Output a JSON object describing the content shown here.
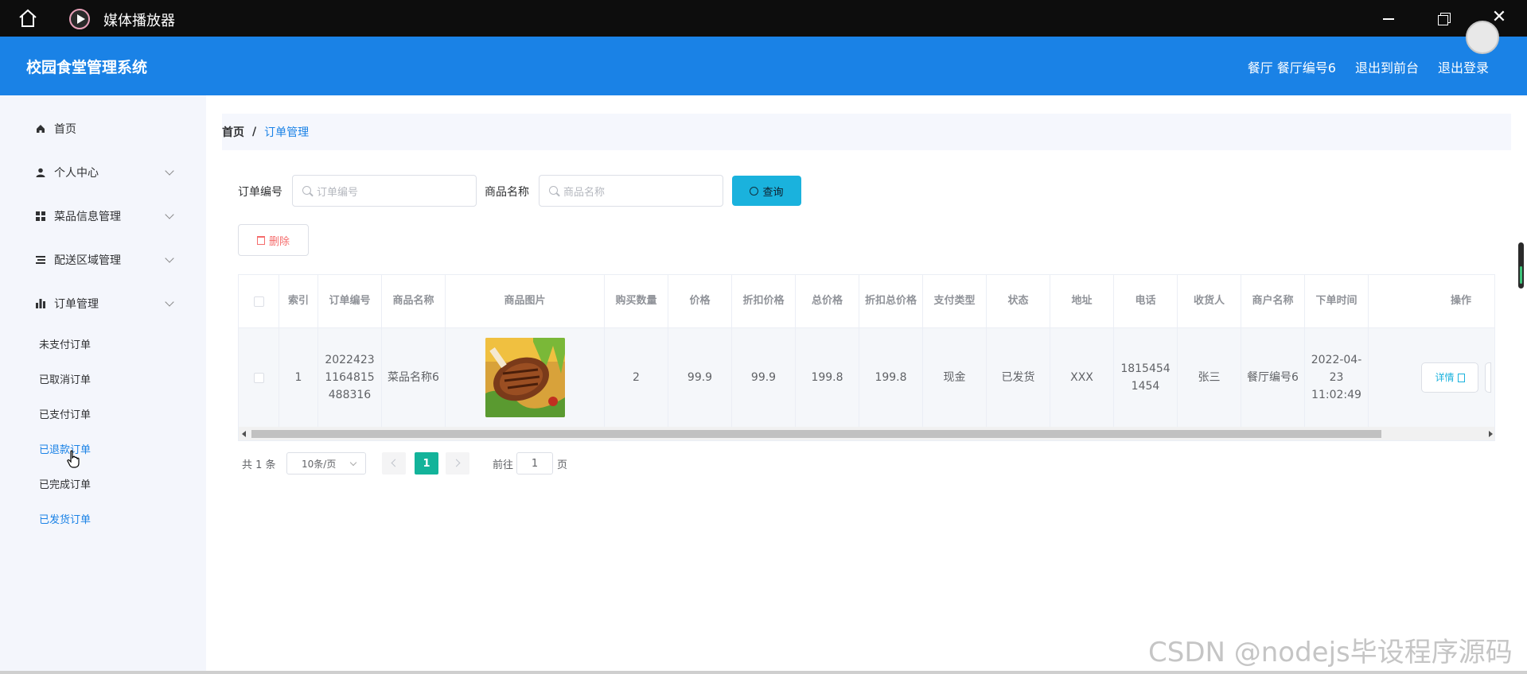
{
  "window": {
    "app_title": "媒体播放器"
  },
  "header": {
    "brand": "校园食堂管理系统",
    "links": [
      "餐厅 餐厅编号6",
      "退出到前台",
      "退出登录"
    ]
  },
  "sidebar": {
    "items": [
      {
        "label": "首页",
        "icon": "home-icon"
      },
      {
        "label": "个人中心",
        "icon": "user-icon"
      },
      {
        "label": "菜品信息管理",
        "icon": "grid-icon"
      },
      {
        "label": "配送区域管理",
        "icon": "list-icon"
      },
      {
        "label": "订单管理",
        "icon": "chart-icon"
      }
    ],
    "sub_items": [
      "未支付订单",
      "已取消订单",
      "已支付订单",
      "已退款订单",
      "已完成订单",
      "已发货订单"
    ]
  },
  "breadcrumb": {
    "home": "首页",
    "separator": "/",
    "current": "订单管理"
  },
  "search": {
    "order_no_label": "订单编号",
    "order_no_placeholder": "订单编号",
    "product_name_label": "商品名称",
    "product_name_placeholder": "商品名称",
    "query_button": "查询"
  },
  "actions": {
    "delete_button": "删除"
  },
  "table": {
    "columns": [
      "索引",
      "订单编号",
      "商品名称",
      "商品图片",
      "购买数量",
      "价格",
      "折扣价格",
      "总价格",
      "折扣总价格",
      "支付类型",
      "状态",
      "地址",
      "电话",
      "收货人",
      "商户名称",
      "下单时间",
      "操作"
    ],
    "rows": [
      {
        "index": "1",
        "order_no": "2022423 1164815 488316",
        "product_name": "菜品名称6",
        "quantity": "2",
        "price": "99.9",
        "discount_price": "99.9",
        "total_price": "199.8",
        "discount_total": "199.8",
        "pay_type": "现金",
        "status": "已发货",
        "address": "XXX",
        "phone": "1815454 1454",
        "receiver": "张三",
        "merchant": "餐厅编号6",
        "order_time": "2022-04-23 11:02:49",
        "detail_button": "详情"
      }
    ]
  },
  "pagination": {
    "total_text": "共 1 条",
    "page_size": "10条/页",
    "current_page": "1",
    "goto_prefix": "前往",
    "goto_value": "1",
    "goto_suffix": "页"
  },
  "watermark": "CSDN @nodejs毕设程序源码",
  "colors": {
    "header": "#1a82e6",
    "accent": "#1ab2dd",
    "page_active": "#13b39a",
    "danger": "#f56c6c"
  }
}
